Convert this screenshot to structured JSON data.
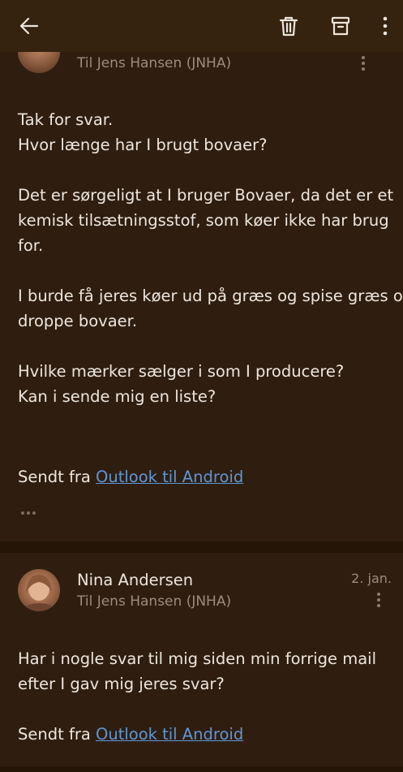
{
  "toolbar": {
    "back_icon": "arrow-left-icon",
    "delete_icon": "trash-icon",
    "archive_icon": "archive-icon",
    "more_icon": "more-vertical-icon"
  },
  "message1": {
    "recipient": "Til Jens Hansen (JNHA)",
    "paragraphs": [
      [
        "Tak for svar.",
        "Hvor længe har I brugt bovaer?"
      ],
      [
        "Det er sørgeligt at I bruger Bovaer, da det er et",
        "kemisk tilsætningsstof, som køer ikke har brug",
        "for."
      ],
      [
        "I burde få jeres køer ud på græs og spise græs og",
        "droppe bovaer."
      ],
      [
        "Hvilke mærker sælger i som I producere?",
        "Kan i sende mig en liste?"
      ]
    ],
    "sent_prefix": "Sendt fra ",
    "sent_link": "Outlook til Android"
  },
  "message2": {
    "sender": "Nina Andersen",
    "recipient": "Til Jens Hansen (JNHA)",
    "date": "2. jan.",
    "body_lines": [
      "Har i nogle svar til mig siden min forrige mail",
      "efter I gav mig jeres svar?"
    ],
    "sent_prefix": "Sendt fra ",
    "sent_link": "Outlook til Android"
  },
  "colors": {
    "background": "#2f1e10",
    "appbar": "#36230f",
    "link": "#5e96d6",
    "muted_text": "#9b8c7d"
  }
}
